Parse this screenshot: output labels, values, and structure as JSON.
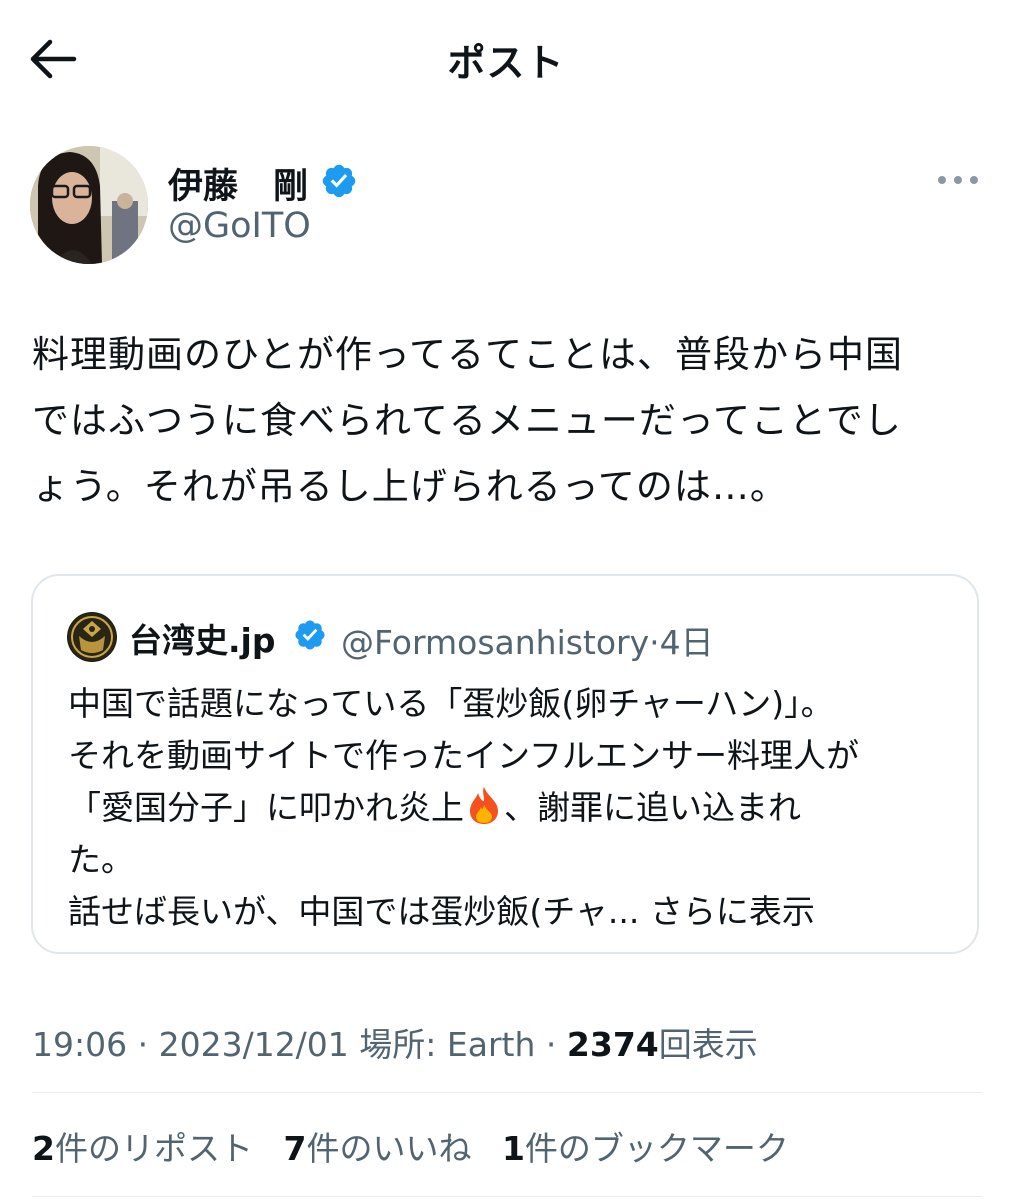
{
  "header": {
    "title": "ポスト"
  },
  "author": {
    "name": "伊藤　剛",
    "handle": "@GoITO"
  },
  "post": {
    "lines": [
      "料理動画のひとが作ってるてことは、普段から中国",
      "ではふつうに食べられてるメニューだってことでし",
      "ょう。それが吊るし上げられるってのは…。"
    ]
  },
  "quote": {
    "name": "台湾史.jp",
    "handle": "@Formosanhistory",
    "separator": "·",
    "time": "4日",
    "lines": [
      "中国で話題になっている「蛋炒飯(卵チャーハン)」。",
      "それを動画サイトで作ったインフルエンサー料理人が",
      "「愛国分子」に叩かれ炎上",
      "、謝罪に追い込まれ",
      "た。",
      "話せば長いが、中国では蛋炒飯(チャ..."
    ],
    "show_more": "さらに表示"
  },
  "meta": {
    "time": "19:06",
    "sep1": " · ",
    "date": "2023/12/01",
    "location_label": " 場所: ",
    "location": "Earth",
    "sep2": " · ",
    "views": "2374",
    "views_label": "回表示"
  },
  "stats": {
    "reposts_count": "2",
    "reposts_label": "件のリポスト",
    "likes_count": "7",
    "likes_label": "件のいいね",
    "bookmarks_count": "1",
    "bookmarks_label": "件のブックマーク"
  },
  "colors": {
    "verified": "#1d9bf0",
    "secondary_text": "#536471",
    "primary_text": "#0f1419",
    "border": "#e1e6ea"
  },
  "icons": {
    "back": "arrow-left-icon",
    "verified": "verified-badge-icon",
    "more": "more-horizontal-icon",
    "flame": "fire-emoji-icon"
  }
}
